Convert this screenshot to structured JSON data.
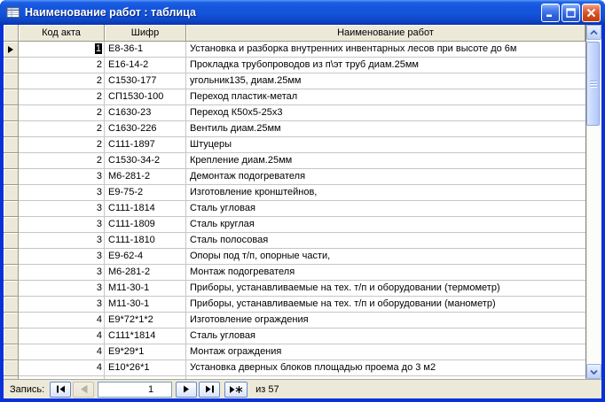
{
  "window": {
    "title": "Наименование работ : таблица",
    "icon": "datasheet-table-icon"
  },
  "table": {
    "columns": [
      "Код акта",
      "Шифр",
      "Наименование работ"
    ],
    "rows": [
      {
        "kod": "1",
        "shifr": "Е8-36-1",
        "name": "Установка и разборка внутренних инвентарных лесов при высоте до 6м",
        "current": true,
        "selected": true
      },
      {
        "kod": "2",
        "shifr": "Е16-14-2",
        "name": "Прокладка трубопроводов из п\\эт труб диам.25мм"
      },
      {
        "kod": "2",
        "shifr": "С1530-177",
        "name": "угольник135, диам.25мм"
      },
      {
        "kod": "2",
        "shifr": "СП1530-100",
        "name": "Переход пластик-метал"
      },
      {
        "kod": "2",
        "shifr": "С1630-23",
        "name": "Переход К50х5-25х3"
      },
      {
        "kod": "2",
        "shifr": "С1630-226",
        "name": "Вентиль диам.25мм"
      },
      {
        "kod": "2",
        "shifr": "С111-1897",
        "name": "Штуцеры"
      },
      {
        "kod": "2",
        "shifr": "С1530-34-2",
        "name": "Крепление диам.25мм"
      },
      {
        "kod": "3",
        "shifr": "М6-281-2",
        "name": "Демонтаж подогревателя"
      },
      {
        "kod": "3",
        "shifr": "Е9-75-2",
        "name": "Изготовление кронштейнов,"
      },
      {
        "kod": "3",
        "shifr": "С111-1814",
        "name": "Сталь угловая"
      },
      {
        "kod": "3",
        "shifr": "С111-1809",
        "name": "Сталь круглая"
      },
      {
        "kod": "3",
        "shifr": "С111-1810",
        "name": "Сталь полосовая"
      },
      {
        "kod": "3",
        "shifr": "Е9-62-4",
        "name": "Опоры под т/п, опорные части,"
      },
      {
        "kod": "3",
        "shifr": "М6-281-2",
        "name": "Монтаж подогревателя"
      },
      {
        "kod": "3",
        "shifr": "М11-30-1",
        "name": "Приборы, устанавливаемые на тех. т/п и оборудовании (термометр)"
      },
      {
        "kod": "3",
        "shifr": "М11-30-1",
        "name": "Приборы, устанавливаемые на тех. т/п и оборудовании (манометр)"
      },
      {
        "kod": "4",
        "shifr": "Е9*72*1*2",
        "name": "Изготовление ограждения"
      },
      {
        "kod": "4",
        "shifr": "С111*1814",
        "name": "Сталь угловая"
      },
      {
        "kod": "4",
        "shifr": "Е9*29*1",
        "name": "Монтаж ограждения"
      },
      {
        "kod": "4",
        "shifr": "Е10*26*1",
        "name": "Установка дверных блоков площадью проема до 3 м2"
      }
    ]
  },
  "nav": {
    "record_label": "Запись:",
    "current_record": "1",
    "of_label": "из 57"
  },
  "icons": {
    "window_controls": [
      "minimize-icon",
      "maximize-icon",
      "close-icon"
    ],
    "record_nav": [
      "first-record-icon",
      "previous-record-icon",
      "next-record-icon",
      "last-record-icon",
      "new-record-icon"
    ],
    "scrollbar": [
      "scroll-up-icon",
      "scroll-down-icon"
    ]
  },
  "colors": {
    "window_border": "#0831D9",
    "titlebar_top": "#3C81F3",
    "titlebar_bottom": "#0A39B5",
    "close_button": "#D04A1D",
    "header_bg": "#ECE9D8",
    "grid_line": "#C6C6C6",
    "selection_bg": "#000000",
    "selection_text": "#FFFFFF"
  }
}
